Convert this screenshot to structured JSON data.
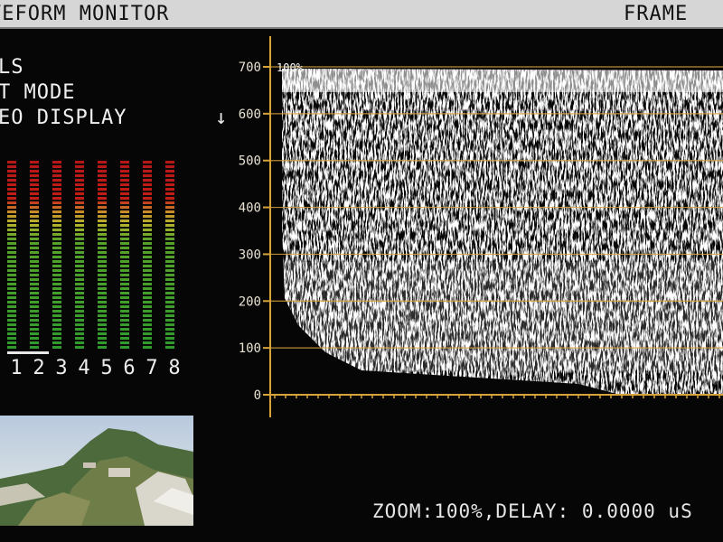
{
  "header": {
    "title": "VEFORM MONITOR",
    "mode": "FRAME"
  },
  "menu": [
    {
      "label": "LS"
    },
    {
      "label": "T MODE"
    },
    {
      "label": "EO DISPLAY"
    }
  ],
  "arrow_glyph": "↓",
  "waveform": {
    "top_label": "100%",
    "scale": [
      "700",
      "600",
      "500",
      "400",
      "300",
      "200",
      "100",
      "0"
    ],
    "graticule_color": "#d8a43a",
    "trace_color": "#ffffff"
  },
  "audio_meters": {
    "channels": [
      "1",
      "2",
      "3",
      "4",
      "5",
      "6",
      "7",
      "8"
    ],
    "selected": [
      "1",
      "2"
    ]
  },
  "thumbnail": {
    "description_icon": "video-thumbnail"
  },
  "status": {
    "zoom_text": "ZOOM:100%,DELAY: 0.0000 uS"
  }
}
